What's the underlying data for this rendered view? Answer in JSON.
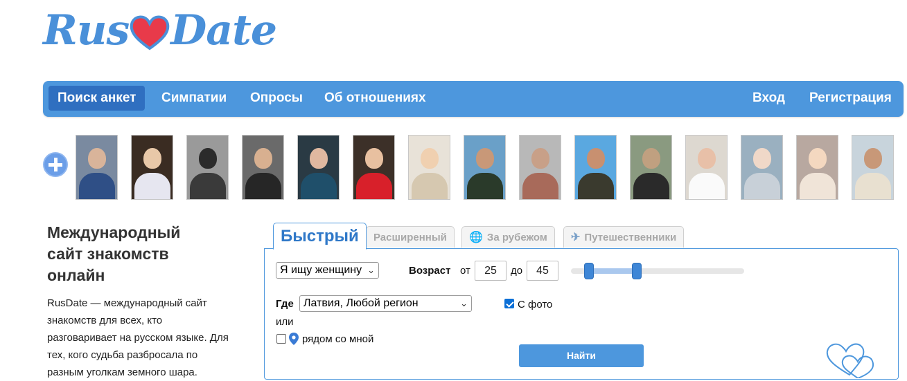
{
  "logo": {
    "text_left": "Rus",
    "text_right": "Date",
    "heart_icon": "heart-icon"
  },
  "nav": {
    "left": [
      {
        "label": "Поиск анкет",
        "active": true
      },
      {
        "label": "Симпатии",
        "active": false
      },
      {
        "label": "Опросы",
        "active": false
      },
      {
        "label": "Об отношениях",
        "active": false
      }
    ],
    "right": [
      {
        "label": "Вход"
      },
      {
        "label": "Регистрация"
      }
    ]
  },
  "photos": {
    "add_icon": "plus-circle-icon",
    "count": 15
  },
  "intro": {
    "title": "Международный сайт знакомств онлайн",
    "text": "RusDate — международный сайт знакомств для всех, кто разговаривает на русском языке. Для тех, кого судьба разбросала по разным уголкам земного шара."
  },
  "tabs": [
    {
      "label": "Быстрый",
      "active": true
    },
    {
      "label": "Расширенный"
    },
    {
      "label": "За рубежом",
      "icon": "globe-icon"
    },
    {
      "label": "Путешественники",
      "icon": "plane-icon"
    }
  ],
  "search": {
    "looking_for": "Я ищу женщину",
    "age_label": "Возраст",
    "from_label": "от",
    "age_from": "25",
    "to_label": "до",
    "age_to": "45",
    "where_label": "Где",
    "location": "Латвия, Любой регион",
    "or_label": "или",
    "near_me_label": "рядом со мной",
    "near_me_checked": false,
    "with_photo_label": "С фото",
    "with_photo_checked": true,
    "find_button": "Найти"
  },
  "colors": {
    "accent": "#4d97dd",
    "active_nav": "#2f6fc0",
    "logo": "#4a90d9",
    "heart": "#e83a4a"
  }
}
